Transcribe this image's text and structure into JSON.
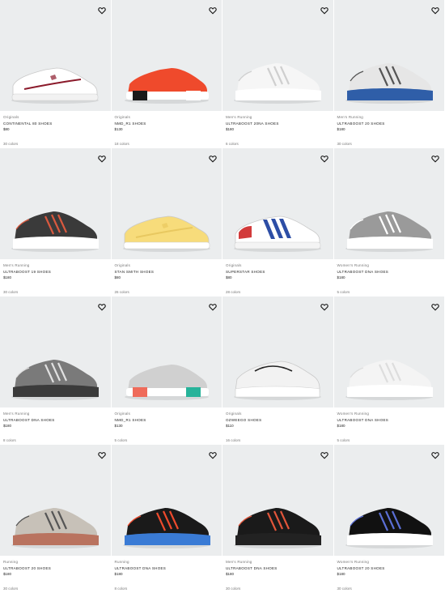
{
  "products": [
    {
      "category": "Originals",
      "name": "CONTINENTAL 80 SHOES",
      "price": "$80",
      "colors": "30 colors",
      "upper": "#ffffff",
      "accent": "#8b1a2b",
      "sole": "#f2f2f2",
      "style": "court"
    },
    {
      "category": "Originals",
      "name": "NMD_R1 SHOES",
      "price": "$130",
      "colors": "18 colors",
      "upper": "#ef4a2c",
      "accent": "#1a1a1a",
      "sole": "#ffffff",
      "style": "nmd"
    },
    {
      "category": "Men's Running",
      "name": "ULTRABOOST 20NA SHOES",
      "price": "$180",
      "colors": "6 colors",
      "upper": "#f6f6f6",
      "accent": "#cfcfcf",
      "sole": "#ffffff",
      "style": "runner"
    },
    {
      "category": "Men's Running",
      "name": "ULTRABOOST 20 SHOES",
      "price": "$180",
      "colors": "30 colors",
      "upper": "#e6e6e6",
      "accent": "#555555",
      "sole": "#2f5ea8",
      "style": "runner"
    },
    {
      "category": "Men's Running",
      "name": "ULTRABOOST 19 SHOES",
      "price": "$180",
      "colors": "30 colors",
      "upper": "#3a3a3a",
      "accent": "#d9593f",
      "sole": "#ffffff",
      "style": "runner"
    },
    {
      "category": "Originals",
      "name": "STAN SMITH SHOES",
      "price": "$80",
      "colors": "26 colors",
      "upper": "#f7dc7b",
      "accent": "#e8c860",
      "sole": "#ffffff",
      "style": "court"
    },
    {
      "category": "Originals",
      "name": "SUPERSTAR SHOES",
      "price": "$80",
      "colors": "28 colors",
      "upper": "#ffffff",
      "accent": "#2d4ea6",
      "sole": "#f4f4f4",
      "style": "superstar"
    },
    {
      "category": "Women's Running",
      "name": "ULTRABOOST DNA SHOES",
      "price": "$180",
      "colors": "5 colors",
      "upper": "#9a9a9a",
      "accent": "#ffffff",
      "sole": "#ffffff",
      "style": "runner"
    },
    {
      "category": "Men's Running",
      "name": "ULTRABOOST DNA SHOES",
      "price": "$180",
      "colors": "8 colors",
      "upper": "#7a7a7a",
      "accent": "#e0e0e0",
      "sole": "#3b3b3b",
      "style": "runner"
    },
    {
      "category": "Originals",
      "name": "NMD_R1 SHOES",
      "price": "$130",
      "colors": "5 colors",
      "upper": "#d0d0d0",
      "accent": "#ef6b5a",
      "sole": "#27b39a",
      "style": "nmd"
    },
    {
      "category": "Originals",
      "name": "OZWEEGO SHOES",
      "price": "$110",
      "colors": "16 colors",
      "upper": "#f2f2f2",
      "accent": "#222222",
      "sole": "#ffffff",
      "style": "ozweego"
    },
    {
      "category": "Women's Running",
      "name": "ULTRABOOST DNA SHOES",
      "price": "$180",
      "colors": "5 colors",
      "upper": "#f4f4f4",
      "accent": "#dddddd",
      "sole": "#ffffff",
      "style": "runner"
    },
    {
      "category": "Running",
      "name": "ULTRABOOST 20 SHOES",
      "price": "$180",
      "colors": "30 colors",
      "upper": "#c7c1b8",
      "accent": "#555555",
      "sole": "#b9735f",
      "style": "runner"
    },
    {
      "category": "Running",
      "name": "ULTRABOOST DNA SHOES",
      "price": "$180",
      "colors": "8 colors",
      "upper": "#1a1a1a",
      "accent": "#ef4a2c",
      "sole": "#3a7bd5",
      "style": "runner"
    },
    {
      "category": "Men's Running",
      "name": "ULTRABOOST DNA SHOES",
      "price": "$180",
      "colors": "30 colors",
      "upper": "#1a1a1a",
      "accent": "#e2553a",
      "sole": "#222222",
      "style": "runner"
    },
    {
      "category": "Women's Running",
      "name": "ULTRABOOST 20 SHOES",
      "price": "$180",
      "colors": "30 colors",
      "upper": "#111111",
      "accent": "#5b6fd6",
      "sole": "#ffffff",
      "style": "runner"
    }
  ]
}
